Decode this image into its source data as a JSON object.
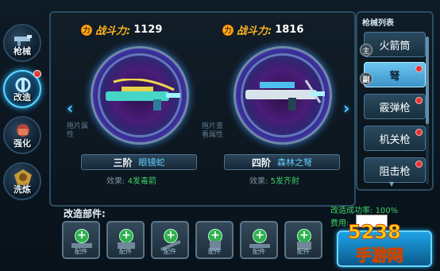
{
  "colors": {
    "accent_blue": "#4fc8ff",
    "power_orange": "#ffb41e",
    "effect_green": "#3ecf6a",
    "dot_red": "#e23b3b"
  },
  "leftnav": {
    "items": [
      {
        "label": "枪械",
        "icon": "gun-icon",
        "active": false,
        "dot": false
      },
      {
        "label": "改造",
        "icon": "wrench-icon",
        "active": true,
        "dot": true
      },
      {
        "label": "强化",
        "icon": "fist-icon",
        "active": false,
        "dot": false
      },
      {
        "label": "洗炼",
        "icon": "badge-icon",
        "active": false,
        "dot": false
      }
    ]
  },
  "cards": [
    {
      "power_label": "战斗力:",
      "power_value": "1129",
      "hint": "拖片属性",
      "tier": "三阶",
      "weapon_name": "眼镜蛇",
      "effect_label": "效果:",
      "effect_value": "4发毒箭"
    },
    {
      "power_label": "战斗力:",
      "power_value": "1816",
      "hint": "拖片查看属性",
      "tier": "四阶",
      "weapon_name": "森林之弩",
      "effect_label": "效果:",
      "effect_value": "5发齐射"
    }
  ],
  "weapon_list": {
    "title": "枪械列表",
    "items": [
      {
        "label": "火箭筒",
        "selected": false,
        "badge": "主",
        "dot": false
      },
      {
        "label": "弩",
        "selected": true,
        "badge": "副",
        "dot": true
      },
      {
        "label": "霰弹枪",
        "selected": false,
        "badge": "",
        "dot": true
      },
      {
        "label": "机关枪",
        "selected": false,
        "badge": "",
        "dot": true
      },
      {
        "label": "阻击枪",
        "selected": false,
        "badge": "",
        "dot": true
      }
    ]
  },
  "parts": {
    "title": "改造部件:",
    "slots": [
      "配件",
      "配件",
      "配件",
      "配件",
      "配件",
      "配件"
    ]
  },
  "status": {
    "rate_label": "改造成功率:",
    "rate_value": "100%",
    "cost_label": "费用:"
  },
  "watermark": {
    "line1": "5238",
    "line2": "手游网"
  }
}
